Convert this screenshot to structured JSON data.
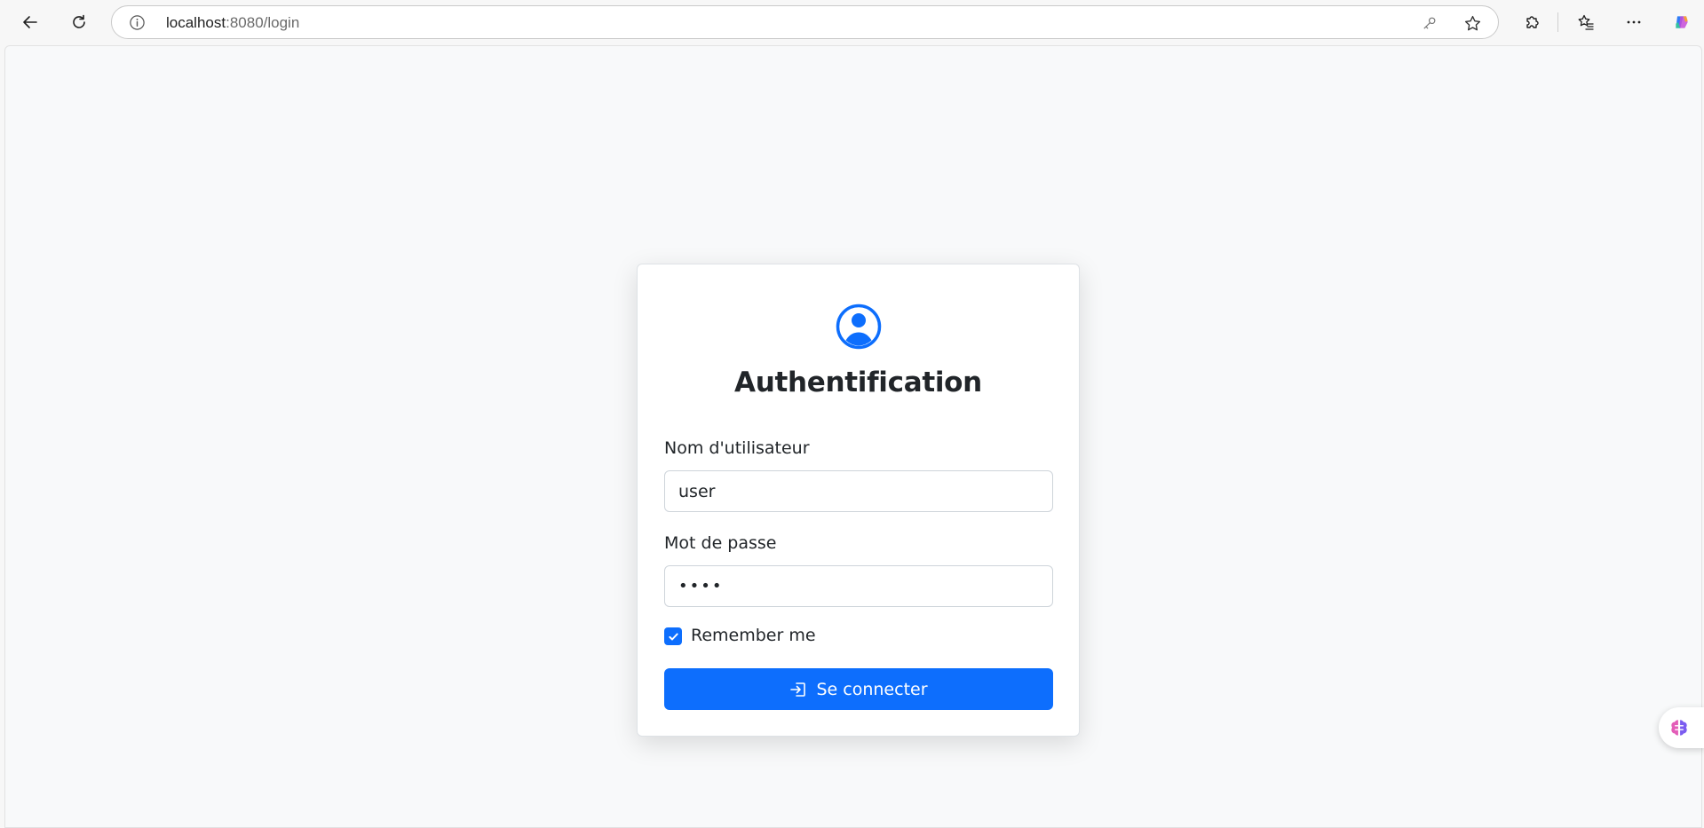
{
  "browser": {
    "url_host": "localhost",
    "url_rest": ":8080/login"
  },
  "login": {
    "title": "Authentification",
    "username_label": "Nom d'utilisateur",
    "username_value": "user",
    "password_label": "Mot de passe",
    "password_value": "••••",
    "remember_label": "Remember me",
    "remember_checked": true,
    "submit_label": "Se connecter"
  },
  "colors": {
    "primary": "#0d6efd",
    "page_background": "#f8f9fa",
    "card_background": "#ffffff"
  },
  "icons": {
    "avatar": "person-circle-icon",
    "submit": "box-arrow-in-right-icon",
    "checkbox": "check-icon"
  }
}
